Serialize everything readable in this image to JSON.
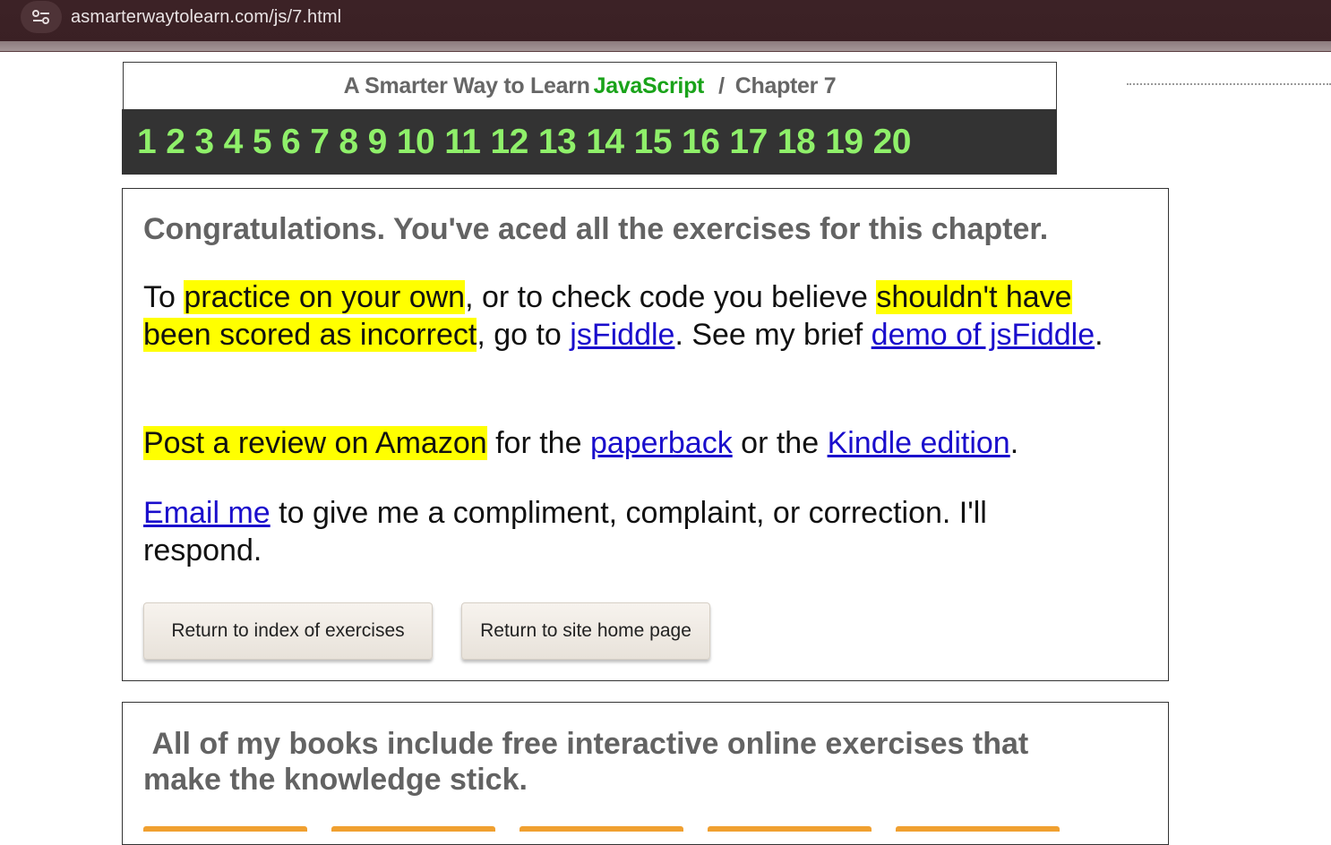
{
  "browser": {
    "url": "asmarterwaytolearn.com/js/7.html"
  },
  "header": {
    "title_prefix": "A Smarter Way to Learn",
    "title_highlight": "JavaScript",
    "separator": "/",
    "chapter": "Chapter 7",
    "chapter_links": [
      "1",
      "2",
      "3",
      "4",
      "5",
      "6",
      "7",
      "8",
      "9",
      "10",
      "11",
      "12",
      "13",
      "14",
      "15",
      "16",
      "17",
      "18",
      "19",
      "20"
    ]
  },
  "main": {
    "heading": "Congratulations. You've aced all the exercises for this chapter.",
    "p1": {
      "t1": "To ",
      "h1": "practice on your own",
      "t2": ", or to check code you believe ",
      "h2": "shouldn't have been scored as incorrect",
      "t3": ", go to ",
      "link1": "jsFiddle",
      "t4": ". See my brief ",
      "link2": "demo of jsFiddle",
      "t5": "."
    },
    "p2": {
      "h1": "Post a review on Amazon",
      "t1": " for the ",
      "link1": "paperback",
      "t2": " or the ",
      "link2": "Kindle edition",
      "t3": "."
    },
    "p3": {
      "link1": "Email me",
      "t1": " to give me a compliment, complaint, or correction. I'll respond."
    },
    "buttons": {
      "index": "Return to index of exercises",
      "home": "Return to site home page"
    }
  },
  "books": {
    "heading": "All of my books include free interactive online exercises that make the knowledge stick."
  },
  "colors": {
    "highlight": "#ffff00",
    "link": "#1a0dcc",
    "nav_bg": "#333333",
    "nav_text": "#8ff06a",
    "javascript_green": "#1aa31a"
  }
}
